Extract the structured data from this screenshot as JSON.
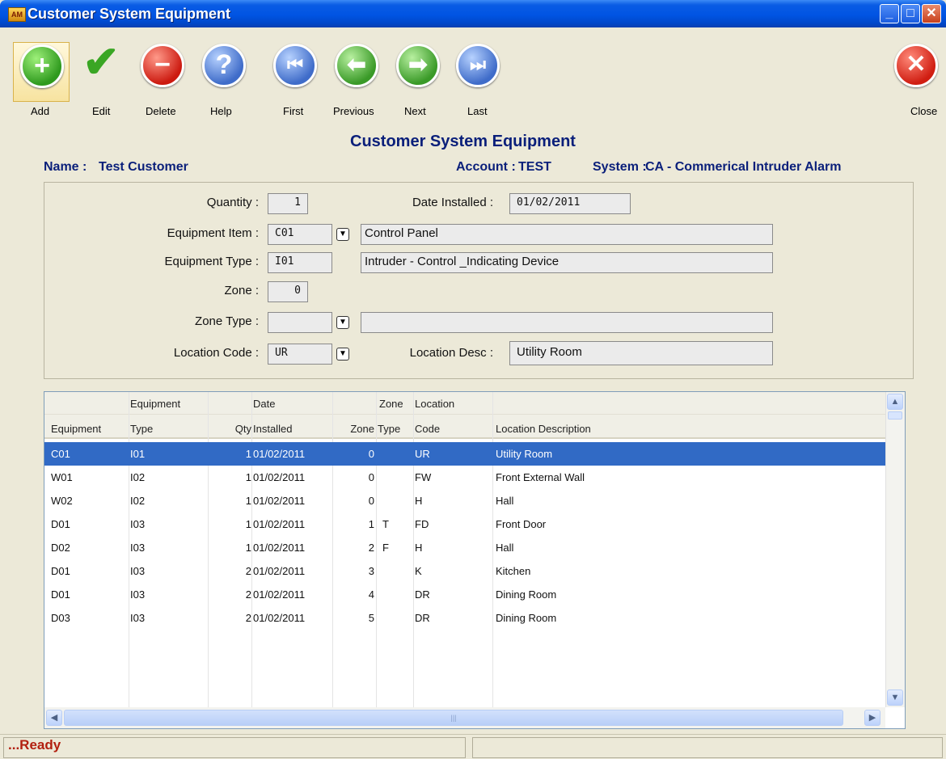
{
  "window": {
    "title": "Customer System Equipment"
  },
  "toolbar": {
    "add": "Add",
    "edit": "Edit",
    "delete": "Delete",
    "help": "Help",
    "first": "First",
    "previous": "Previous",
    "next": "Next",
    "last": "Last",
    "close": "Close"
  },
  "header": {
    "title": "Customer System Equipment",
    "name_label": "Name :",
    "name_value": "Test Customer",
    "account_label": "Account :",
    "account_value": "TEST",
    "system_label": "System :",
    "system_value": "CA - Commerical Intruder Alarm"
  },
  "form": {
    "quantity_label": "Quantity :",
    "quantity": "1",
    "date_installed_label": "Date Installed :",
    "date_installed": "01/02/2011",
    "equipment_item_label": "Equipment Item :",
    "equipment_item_code": "C01",
    "equipment_item_desc": "Control Panel",
    "equipment_type_label": "Equipment Type :",
    "equipment_type_code": "I01",
    "equipment_type_desc": "Intruder - Control _Indicating Device",
    "zone_label": "Zone :",
    "zone": "0",
    "zone_type_label": "Zone Type :",
    "zone_type_code": "",
    "zone_type_desc": "",
    "location_code_label": "Location Code :",
    "location_code": "UR",
    "location_desc_label": "Location Desc :",
    "location_desc": "Utility Room"
  },
  "grid": {
    "header_top": [
      "",
      "Equipment",
      "",
      "Date",
      "",
      "Zone",
      "Location",
      ""
    ],
    "header_bottom": [
      "Equipment",
      "Type",
      "Qty",
      "Installed",
      "Zone",
      "Type",
      "Code",
      "Location Description"
    ],
    "rows": [
      [
        "C01",
        "I01",
        "1",
        "01/02/2011",
        "0",
        "",
        "UR",
        "Utility Room"
      ],
      [
        "W01",
        "I02",
        "1",
        "01/02/2011",
        "0",
        "",
        "FW",
        "Front External Wall"
      ],
      [
        "W02",
        "I02",
        "1",
        "01/02/2011",
        "0",
        "",
        "H",
        "Hall"
      ],
      [
        "D01",
        "I03",
        "1",
        "01/02/2011",
        "1",
        "T",
        "FD",
        "Front Door"
      ],
      [
        "D02",
        "I03",
        "1",
        "01/02/2011",
        "2",
        "F",
        "H",
        "Hall"
      ],
      [
        "D01",
        "I03",
        "2",
        "01/02/2011",
        "3",
        "",
        "K",
        "Kitchen"
      ],
      [
        "D01",
        "I03",
        "2",
        "01/02/2011",
        "4",
        "",
        "DR",
        "Dining Room"
      ],
      [
        "D03",
        "I03",
        "2",
        "01/02/2011",
        "5",
        "",
        "DR",
        "Dining Room"
      ]
    ],
    "selected_row": 0
  },
  "status": {
    "text": "...Ready"
  },
  "icons": {
    "add": "plus-icon",
    "edit": "checkmark-icon",
    "delete": "minus-icon",
    "help": "question-icon",
    "first": "skip-back-icon",
    "previous": "arrow-left-icon",
    "next": "arrow-right-icon",
    "last": "skip-forward-icon",
    "close": "x-icon"
  },
  "colors": {
    "title_blue": "#0a1f7a",
    "selection": "#316ac5",
    "status_red": "#b21f0f"
  }
}
